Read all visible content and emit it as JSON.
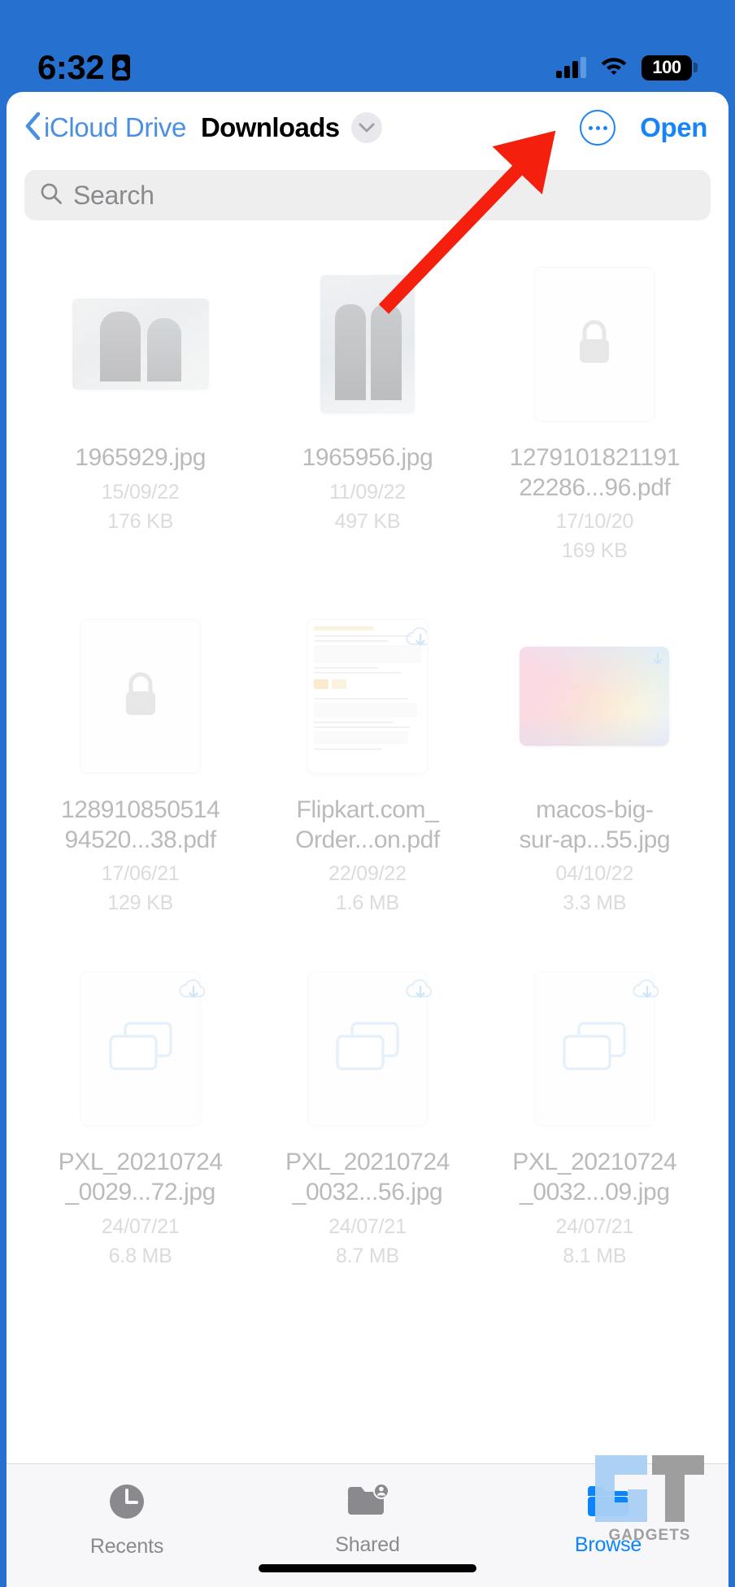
{
  "status_bar": {
    "time": "6:32",
    "battery_percent": "100",
    "signal_icon": "cellular-signal-icon",
    "wifi_icon": "wifi-icon",
    "battery_icon": "battery-icon",
    "dynamic_island_icon": "face-id-lock-icon",
    "background_color": "#2671cf"
  },
  "nav_bar": {
    "back_label": "iCloud Drive",
    "back_icon": "chevron-left-icon",
    "title": "Downloads",
    "title_chevron_icon": "chevron-down-icon",
    "more_icon": "ellipsis-circle-icon",
    "open_label": "Open",
    "accent_color": "#1884f7"
  },
  "search": {
    "placeholder": "Search",
    "icon": "search-icon"
  },
  "files": [
    {
      "name": "1965929.jpg",
      "date": "15/09/22",
      "size": "176 KB",
      "thumb": "photo-landscape",
      "cloud": false
    },
    {
      "name": "1965956.jpg",
      "date": "11/09/22",
      "size": "497 KB",
      "thumb": "photo-portrait",
      "cloud": false
    },
    {
      "name": "1279101821191 22286...96.pdf",
      "name_line1": "1279101821191",
      "name_line2": "22286...96.pdf",
      "date": "17/10/20",
      "size": "169 KB",
      "thumb": "locked-document",
      "cloud": false
    },
    {
      "name": "128910850514 94520...38.pdf",
      "name_line1": "128910850514",
      "name_line2": "94520...38.pdf",
      "date": "17/06/21",
      "size": "129 KB",
      "thumb": "locked-document",
      "cloud": false
    },
    {
      "name": "Flipkart.com_ Order...on.pdf",
      "name_line1": "Flipkart.com_",
      "name_line2": "Order...on.pdf",
      "date": "22/09/22",
      "size": "1.6 MB",
      "thumb": "receipt-document",
      "cloud": true
    },
    {
      "name": "macos-big- sur-ap...55.jpg",
      "name_line1": "macos-big-",
      "name_line2": "sur-ap...55.jpg",
      "date": "04/10/22",
      "size": "3.3 MB",
      "thumb": "wallpaper-image",
      "cloud": true
    },
    {
      "name": "PXL_20210724 _0029...72.jpg",
      "name_line1": "PXL_20210724",
      "name_line2": "_0029...72.jpg",
      "date": "24/07/21",
      "size": "6.8 MB",
      "thumb": "image-stack",
      "cloud": true
    },
    {
      "name": "PXL_20210724 _0032...56.jpg",
      "name_line1": "PXL_20210724",
      "name_line2": "_0032...56.jpg",
      "date": "24/07/21",
      "size": "8.7 MB",
      "thumb": "image-stack",
      "cloud": true
    },
    {
      "name": "PXL_20210724 _0032...09.jpg",
      "name_line1": "PXL_20210724",
      "name_line2": "_0032...09.jpg",
      "date": "24/07/21",
      "size": "8.1 MB",
      "thumb": "image-stack",
      "cloud": true
    }
  ],
  "tab_bar": {
    "tabs": [
      {
        "label": "Recents",
        "icon": "clock-icon",
        "active": false
      },
      {
        "label": "Shared",
        "icon": "shared-folder-icon",
        "active": false
      },
      {
        "label": "Browse",
        "icon": "folder-icon",
        "active": true
      }
    ],
    "active_color": "#0a84ff",
    "inactive_color": "#8a8a8e"
  },
  "annotation": {
    "arrow_color": "#f41f0c",
    "points_to": "Open"
  },
  "watermark": {
    "text": "GADGETS",
    "logo": "gt-logo"
  }
}
